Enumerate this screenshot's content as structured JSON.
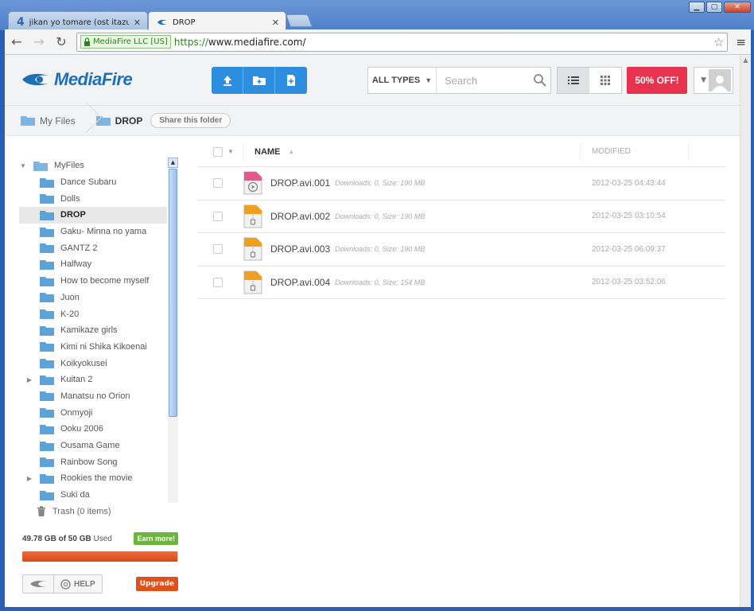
{
  "browser": {
    "tabs": [
      {
        "title": "jikan yo tomare (ost itazura n",
        "active": false
      },
      {
        "title": "DROP",
        "active": true
      }
    ],
    "ev_label": "MediaFire LLC [US]",
    "url_scheme": "https://",
    "url_rest": "www.mediafire.com/"
  },
  "header": {
    "logo": "MediaFire",
    "types_label": "ALL TYPES",
    "search_placeholder": "Search",
    "promo_label": "50% OFF!"
  },
  "breadcrumb": {
    "root": "My Files",
    "current": "DROP",
    "share_label": "Share this folder"
  },
  "sidebar": {
    "root": "MyFiles",
    "folders": [
      {
        "name": "Dance Subaru",
        "expandable": false,
        "selected": false
      },
      {
        "name": "Dolls",
        "expandable": false,
        "selected": false
      },
      {
        "name": "DROP",
        "expandable": false,
        "selected": true
      },
      {
        "name": "Gaku- Minna no yama",
        "expandable": false,
        "selected": false
      },
      {
        "name": "GANTZ 2",
        "expandable": false,
        "selected": false
      },
      {
        "name": "Halfway",
        "expandable": false,
        "selected": false
      },
      {
        "name": "How to become myself",
        "expandable": false,
        "selected": false
      },
      {
        "name": "Juon",
        "expandable": false,
        "selected": false
      },
      {
        "name": "K-20",
        "expandable": false,
        "selected": false
      },
      {
        "name": "Kamikaze girls",
        "expandable": false,
        "selected": false
      },
      {
        "name": "Kimi ni Shika Kikoenai",
        "expandable": false,
        "selected": false
      },
      {
        "name": "Koikyokusei",
        "expandable": false,
        "selected": false
      },
      {
        "name": "Kuitan 2",
        "expandable": true,
        "selected": false
      },
      {
        "name": "Manatsu no Orion",
        "expandable": false,
        "selected": false
      },
      {
        "name": "Onmyoji",
        "expandable": false,
        "selected": false
      },
      {
        "name": "Ooku 2006",
        "expandable": false,
        "selected": false
      },
      {
        "name": "Ousama Game",
        "expandable": false,
        "selected": false
      },
      {
        "name": "Rainbow Song",
        "expandable": false,
        "selected": false
      },
      {
        "name": "Rookies the movie",
        "expandable": true,
        "selected": false
      },
      {
        "name": "Suki da",
        "expandable": false,
        "selected": false
      }
    ],
    "trash_label": "Trash (0 items)",
    "storage_used": "49.78 GB of 50 GB",
    "storage_suffix": "Used",
    "storage_fraction": 0.9956,
    "earn_label": "Earn more!",
    "help_label": "HELP",
    "upgrade_label": "Upgrade"
  },
  "filelist": {
    "col_name": "NAME",
    "col_modified": "MODIFIED",
    "files": [
      {
        "name": "DROP.avi.001",
        "meta": "Downloads: 0, Size: 190 MB",
        "modified": "2012-03-25 04:43:44",
        "icon": "video-file-icon"
      },
      {
        "name": "DROP.avi.002",
        "meta": "Downloads: 0, Size: 190 MB",
        "modified": "2012-03-25 03:10:54",
        "icon": "archive-file-icon"
      },
      {
        "name": "DROP.avi.003",
        "meta": "Downloads: 0, Size: 190 MB",
        "modified": "2012-03-25 06:09:37",
        "icon": "archive-file-icon"
      },
      {
        "name": "DROP.avi.004",
        "meta": "Downloads: 0, Size: 154 MB",
        "modified": "2012-03-25 03:52:06",
        "icon": "archive-file-icon"
      }
    ]
  },
  "colors": {
    "brand_blue": "#2d8ee0",
    "promo_red": "#e8334e",
    "folder_blue": "#5ea3d8",
    "earn_green": "#6cb33f",
    "upgrade_orange": "#e0501c"
  }
}
